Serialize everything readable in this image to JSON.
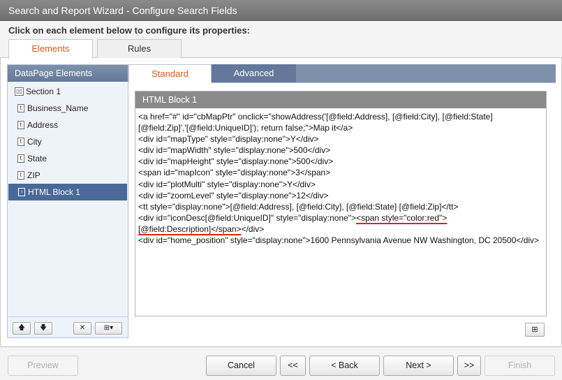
{
  "window": {
    "title": "Search and Report Wizard - Configure Search Fields"
  },
  "instruction": "Click on each element below to configure its properties:",
  "top_tabs": [
    {
      "label": "Elements",
      "active": true
    },
    {
      "label": "Rules",
      "active": false
    }
  ],
  "left_panel": {
    "title": "DataPage Elements",
    "items": [
      {
        "label": "Section 1",
        "icon": "section-icon",
        "icon_glyph": "▯▯"
      },
      {
        "label": "Business_Name",
        "icon": "text-field-icon",
        "icon_glyph": "t"
      },
      {
        "label": "Address",
        "icon": "text-field-icon",
        "icon_glyph": "t"
      },
      {
        "label": "City",
        "icon": "text-field-icon",
        "icon_glyph": "t"
      },
      {
        "label": "State",
        "icon": "text-field-icon",
        "icon_glyph": "t"
      },
      {
        "label": "ZIP",
        "icon": "text-field-icon",
        "icon_glyph": "t"
      },
      {
        "label": "HTML Block 1",
        "icon": "html-block-icon",
        "icon_glyph": "›",
        "selected": true
      }
    ],
    "buttons": {
      "up": "🡅",
      "down": "🡇",
      "delete": "✕",
      "insert": "⊞▾"
    }
  },
  "inner_tabs": [
    {
      "label": "Standard",
      "active": true
    },
    {
      "label": "Advanced",
      "active": false
    }
  ],
  "html_block": {
    "title": "HTML Block 1",
    "code_before": "<a href=\"#\" id=\"cbMapPtr\" onclick=\"showAddress('[@field:Address], [@field:City], [@field:State] [@field:Zip]','[@field:UniqueID]'); return false;\">Map it</a>\n<div id=\"mapType\" style=\"display:none\">Y</div>\n<div id=\"mapWidth\" style=\"display:none\">500</div>\n<div id=\"mapHeight\" style=\"display:none\">500</div>\n<span id=\"mapIcon\" style=\"display:none\">3</span>\n<div id=\"plotMulti\" style=\"display:none\">Y</div>\n<div id=\"zoomLevel\" style=\"display:none\">12</div>\n<tt style=\"display:none\">[@field:Address], [@field:City], [@field:State] [@field:Zip]</tt>\n<div id=\"iconDesc[@field:UniqueID]\" style=\"display:none\">",
    "code_highlight_1": "<span style=\"color:red\">",
    "code_linebreak": "\n",
    "code_highlight_2": "[@field:Description]</span>",
    "code_after": "</div>\n<div id=\"home_position\" style=\"display:none\">1600 Pennsylvania Avenue NW Washington, DC 20500</div>"
  },
  "corner_button": "⊞",
  "footer": {
    "preview": "Preview",
    "cancel": "Cancel",
    "first": "<<",
    "back": "< Back",
    "next": "Next >",
    "last": ">>",
    "finish": "Finish"
  },
  "colors": {
    "active_tab": "#e0561b",
    "selected_row": "#4a6898",
    "highlight_underline": "#e02020"
  }
}
